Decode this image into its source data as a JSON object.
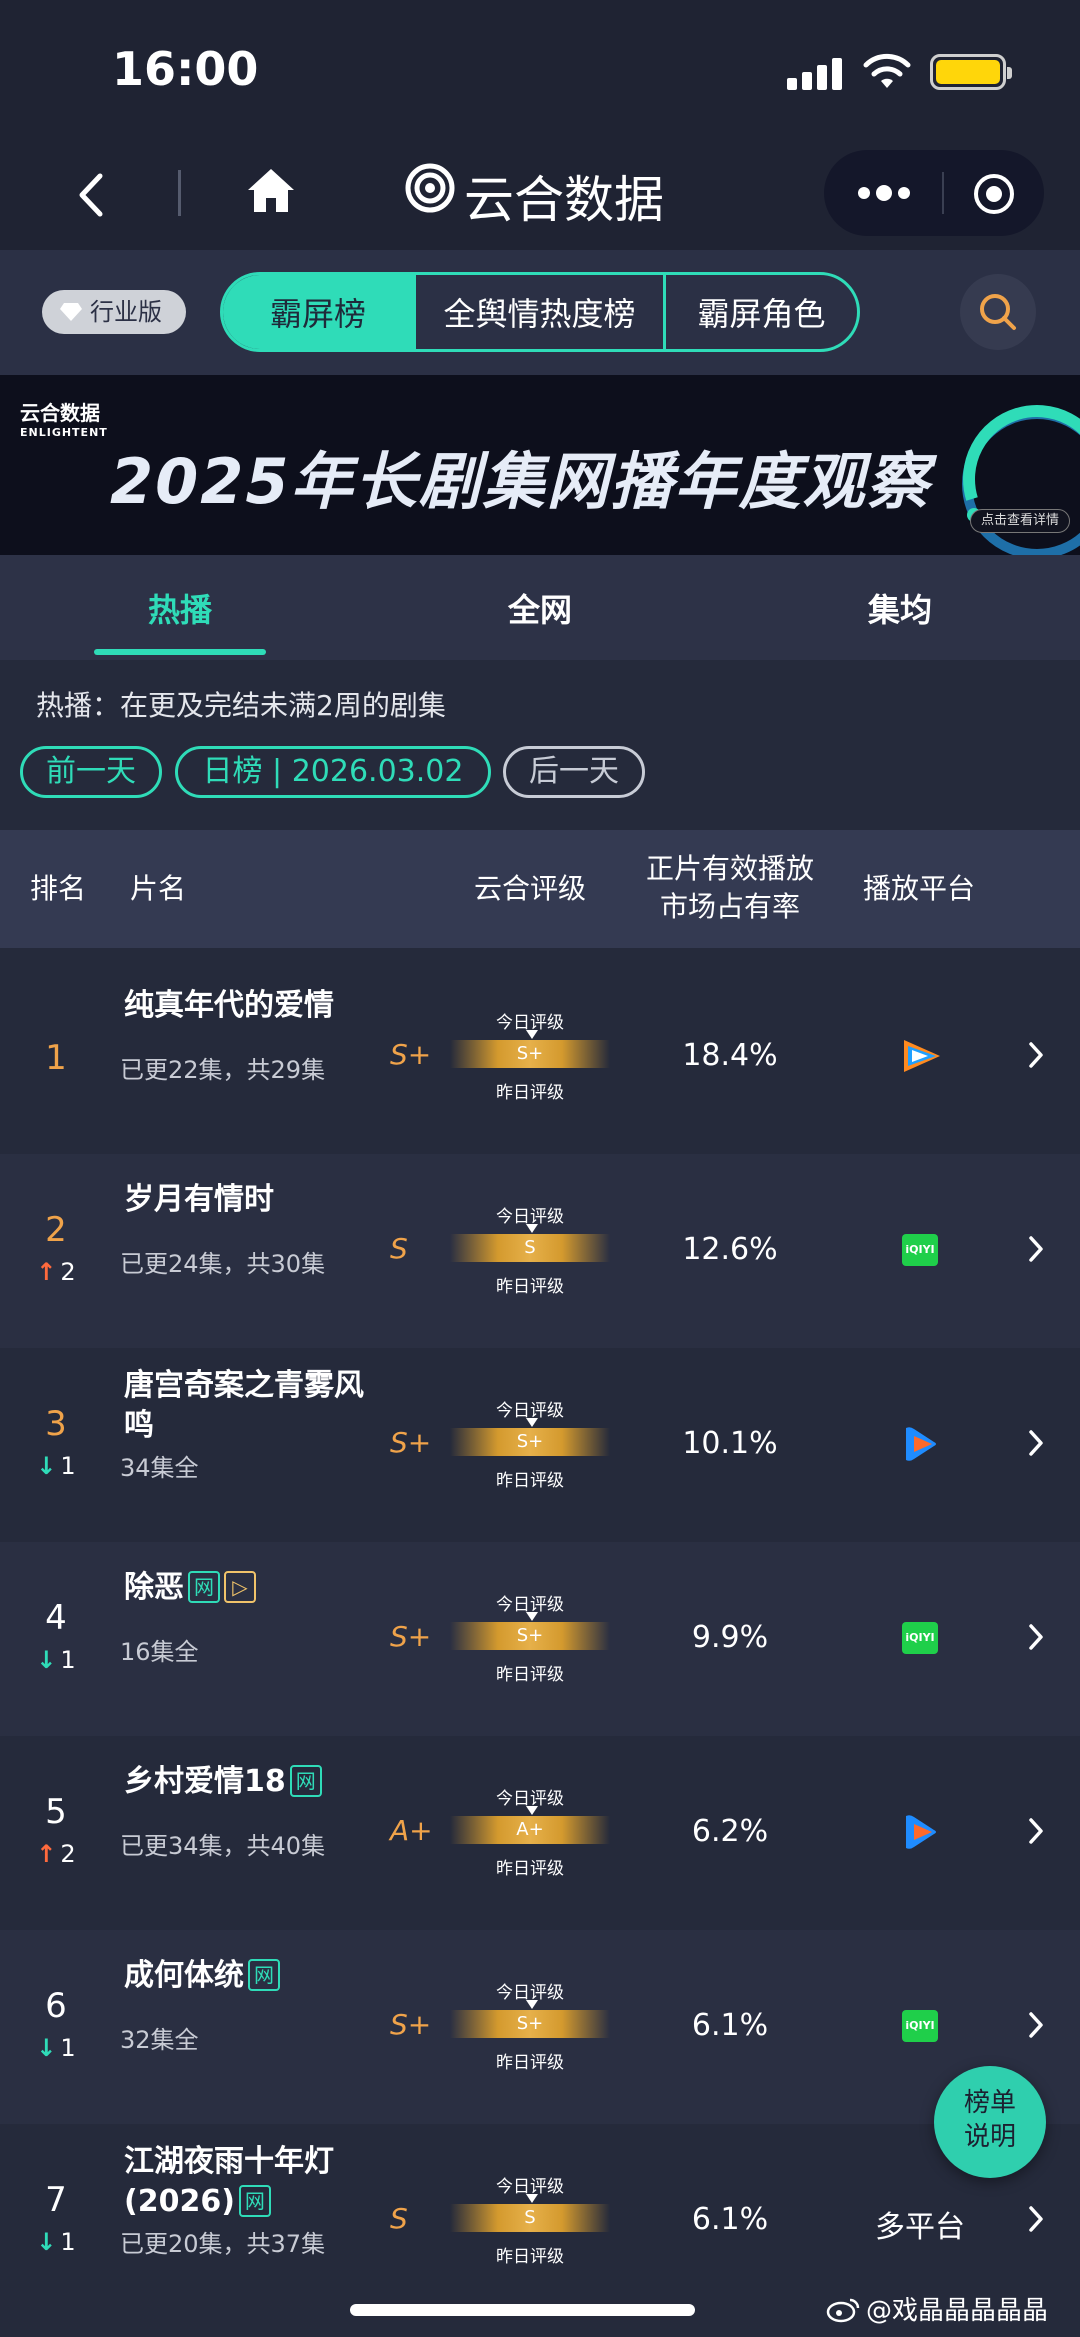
{
  "status_bar": {
    "time": "16:00"
  },
  "nav": {
    "title": "云合数据"
  },
  "filter": {
    "edition_badge": "行业版",
    "segments": [
      "霸屏榜",
      "全舆情热度榜",
      "霸屏角色"
    ],
    "active_segment": 0
  },
  "banner": {
    "logo": "云合数据",
    "logo_sub": "ENLIGHTENT",
    "title": "2025年长剧集网播年度观察",
    "cta": "点击查看详情"
  },
  "tabs": [
    "热播",
    "全网",
    "集均"
  ],
  "active_tab": 0,
  "sub": {
    "description": "热播：在更及完结未满2周的剧集",
    "prev_day": "前一天",
    "date_label": "日榜 | 2026.03.02",
    "next_day": "后一天"
  },
  "table_headers": {
    "rank": "排名",
    "title": "片名",
    "grade": "云合评级",
    "share_line1": "正片有效播放",
    "share_line2": "市场占有率",
    "platform": "播放平台"
  },
  "grade_labels": {
    "today": "今日评级",
    "yesterday": "昨日评级"
  },
  "rows": [
    {
      "rank": "1",
      "change": "",
      "dir": "",
      "name": "纯真年代的爱情",
      "tags": [],
      "eps": "已更22集，共29集",
      "grade": "S+",
      "bar_grade": "S+",
      "share": "18.4%",
      "platform": "tencent",
      "platform_text": ""
    },
    {
      "rank": "2",
      "change": "2",
      "dir": "up",
      "name": "岁月有情时",
      "tags": [],
      "eps": "已更24集，共30集",
      "grade": "S",
      "bar_grade": "S",
      "share": "12.6%",
      "platform": "iqiyi",
      "platform_text": ""
    },
    {
      "rank": "3",
      "change": "1",
      "dir": "down",
      "name": "唐宫奇案之青雾风鸣",
      "tags": [],
      "eps": "34集全",
      "grade": "S+",
      "bar_grade": "S+",
      "share": "10.1%",
      "platform": "youku",
      "platform_text": ""
    },
    {
      "rank": "4",
      "change": "1",
      "dir": "down",
      "name": "除恶",
      "tags": [
        "网",
        "▷"
      ],
      "eps": "16集全",
      "grade": "S+",
      "bar_grade": "S+",
      "share": "9.9%",
      "platform": "iqiyi",
      "platform_text": ""
    },
    {
      "rank": "5",
      "change": "2",
      "dir": "up",
      "name": "乡村爱情18",
      "tags": [
        "网"
      ],
      "eps": "已更34集，共40集",
      "grade": "A+",
      "bar_grade": "A+",
      "share": "6.2%",
      "platform": "youku",
      "platform_text": ""
    },
    {
      "rank": "6",
      "change": "1",
      "dir": "down",
      "name": "成何体统",
      "tags": [
        "网"
      ],
      "eps": "32集全",
      "grade": "S+",
      "bar_grade": "S+",
      "share": "6.1%",
      "platform": "iqiyi",
      "platform_text": ""
    },
    {
      "rank": "7",
      "change": "1",
      "dir": "down",
      "name": "江湖夜雨十年灯(2026)",
      "tags": [
        "网"
      ],
      "eps": "已更20集，共37集",
      "grade": "S",
      "bar_grade": "S",
      "share": "6.1%",
      "platform": "multi",
      "platform_text": "多平台"
    }
  ],
  "iqiyi_label": "iQIYI",
  "float_button": {
    "line1": "榜单",
    "line2": "说明"
  },
  "watermark": "@戏晶晶晶晶晶",
  "colors": {
    "accent": "#2fdcb8",
    "grade": "#f0a34a",
    "up": "#ff6a3d",
    "down": "#2fdcb8"
  }
}
